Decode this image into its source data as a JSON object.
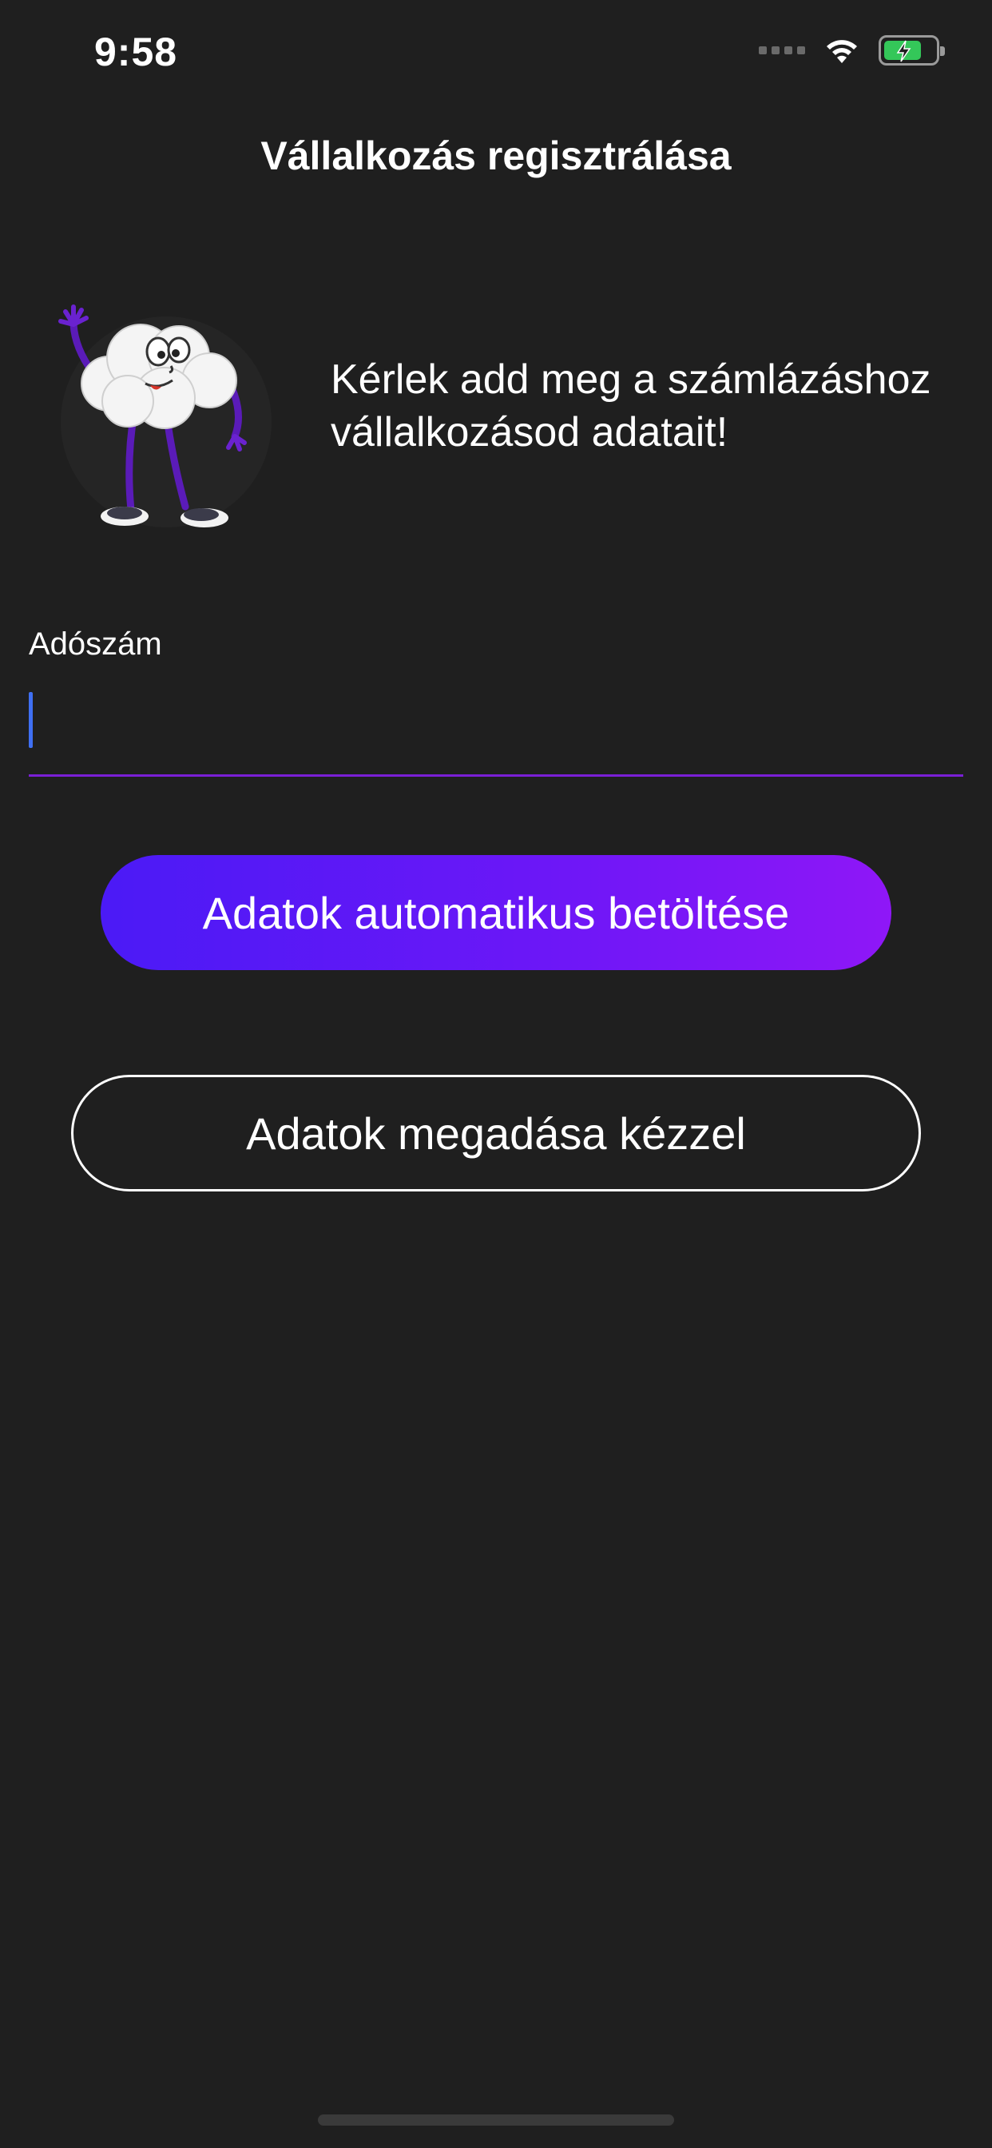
{
  "status_bar": {
    "time": "9:58",
    "icons": [
      "signal-dots-icon",
      "wifi-icon",
      "battery-charging-icon"
    ],
    "battery_color": "#34c759"
  },
  "header": {
    "title": "Vállalkozás regisztrálása"
  },
  "intro": {
    "mascot_icon": "cloud-mascot-icon",
    "text": "Kérlek add meg a számlázáshoz vállalkozásod adatait!"
  },
  "form": {
    "tax_number_label": "Adószám",
    "tax_number_value": "",
    "tax_number_placeholder": "",
    "underline_color": "#7a1fd6"
  },
  "actions": {
    "auto_load_label": "Adatok automatikus betöltése",
    "manual_entry_label": "Adatok megadása kézzel",
    "primary_gradient": [
      "#4b1af6",
      "#8f17f7"
    ]
  },
  "colors": {
    "background": "#1f1f1f",
    "text": "#ffffff"
  }
}
